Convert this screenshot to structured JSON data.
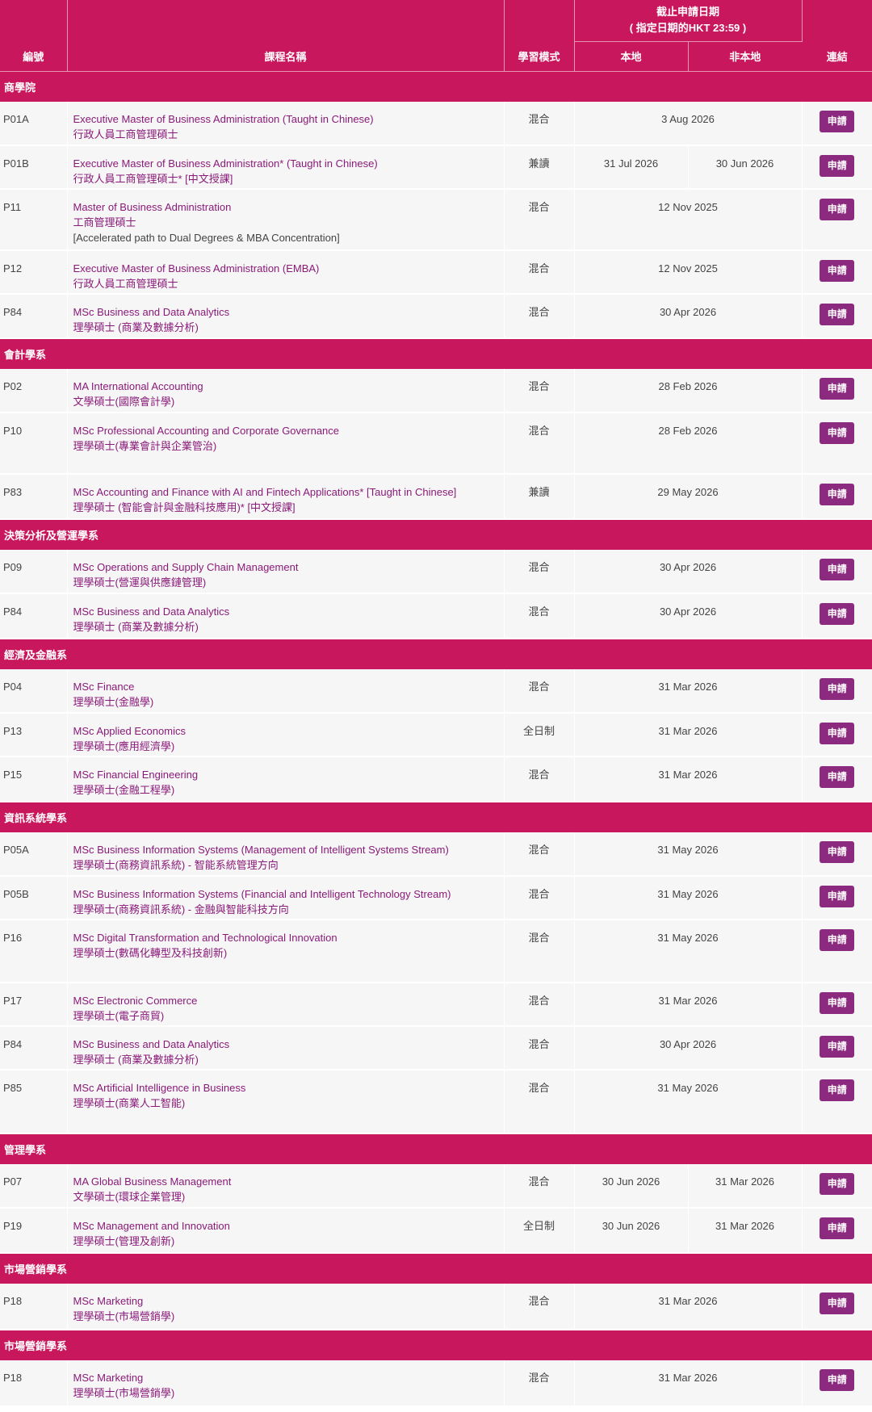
{
  "headers": {
    "code": "編號",
    "name": "課程名稱",
    "mode": "學習模式",
    "deadline_line1": "截止申請日期",
    "deadline_line2": "( 指定日期的HKT 23:59 )",
    "local": "本地",
    "nonlocal": "非本地",
    "link": "連結"
  },
  "apply_label": "申請",
  "sections": [
    {
      "title": "商學院",
      "programmes": [
        {
          "code": "P01A",
          "en": "Executive Master of Business Administration (Taught in Chinese)",
          "zh": "行政人員工商管理碩士",
          "extra": "",
          "mode": "混合",
          "deadline": "3 Aug 2026",
          "local": "",
          "nonlocal": "",
          "h": 54
        },
        {
          "code": "P01B",
          "en": "Executive Master of Business Administration* (Taught in Chinese)",
          "zh": "行政人員工商管理碩士* [中文授課]",
          "extra": "",
          "mode": "兼讀",
          "deadline": "",
          "local": "31 Jul 2026",
          "nonlocal": "30 Jun 2026",
          "h": 54
        },
        {
          "code": "P11",
          "en": "Master of Business Administration",
          "zh": "工商管理碩士",
          "extra": "[Accelerated path to Dual Degrees & MBA Concentration]",
          "mode": "混合",
          "deadline": "12 Nov 2025",
          "local": "",
          "nonlocal": "",
          "h": 76
        },
        {
          "code": "P12",
          "en": "Executive Master of Business Administration (EMBA)",
          "zh": "行政人員工商管理碩士",
          "extra": "",
          "mode": "混合",
          "deadline": "12 Nov 2025",
          "local": "",
          "nonlocal": "",
          "h": 54
        },
        {
          "code": "P84",
          "en": "MSc Business and Data Analytics",
          "zh": "理學碩士 (商業及數據分析)",
          "extra": "",
          "mode": "混合",
          "deadline": "30 Apr 2026",
          "local": "",
          "nonlocal": "",
          "h": 55
        }
      ]
    },
    {
      "title": "會計學系",
      "programmes": [
        {
          "code": "P02",
          "en": "MA International Accounting",
          "zh": "文學碩士(國際會計學)",
          "extra": "",
          "mode": "混合",
          "deadline": "28 Feb 2026",
          "local": "",
          "nonlocal": "",
          "h": 54
        },
        {
          "code": "P10",
          "en": "MSc Professional Accounting and Corporate Governance",
          "zh": "理學碩士(專業會計與企業管治)",
          "extra": "",
          "mode": "混合",
          "deadline": "28 Feb 2026",
          "local": "",
          "nonlocal": "",
          "h": 76
        },
        {
          "code": "P83",
          "en": "MSc Accounting and Finance with AI and Fintech Applications* [Taught in Chinese]",
          "zh": "理學碩士 (智能會計與金融科技應用)* [中文授課]",
          "extra": "",
          "mode": "兼讀",
          "deadline": "29 May 2026",
          "local": "",
          "nonlocal": "",
          "h": 56
        }
      ]
    },
    {
      "title": "決策分析及營運學系",
      "programmes": [
        {
          "code": "P09",
          "en": "MSc Operations and Supply Chain Management",
          "zh": "理學碩士(營運與供應鏈管理)",
          "extra": "",
          "mode": "混合",
          "deadline": "30 Apr 2026",
          "local": "",
          "nonlocal": "",
          "h": 54
        },
        {
          "code": "P84",
          "en": "MSc Business and Data Analytics",
          "zh": "理學碩士 (商業及數據分析)",
          "extra": "",
          "mode": "混合",
          "deadline": "30 Apr 2026",
          "local": "",
          "nonlocal": "",
          "h": 56
        }
      ]
    },
    {
      "title": "經濟及金融系",
      "programmes": [
        {
          "code": "P04",
          "en": "MSc Finance",
          "zh": "理學碩士(金融學)",
          "extra": "",
          "mode": "混合",
          "deadline": "31 Mar 2026",
          "local": "",
          "nonlocal": "",
          "h": 54
        },
        {
          "code": "P13",
          "en": "MSc Applied Economics",
          "zh": "理學碩士(應用經濟學)",
          "extra": "",
          "mode": "全日制",
          "deadline": "31 Mar 2026",
          "local": "",
          "nonlocal": "",
          "h": 54
        },
        {
          "code": "P15",
          "en": "MSc Financial Engineering",
          "zh": "理學碩士(金融工程學)",
          "extra": "",
          "mode": "混合",
          "deadline": "31 Mar 2026",
          "local": "",
          "nonlocal": "",
          "h": 56
        }
      ]
    },
    {
      "title": "資訊系統學系",
      "programmes": [
        {
          "code": "P05A",
          "en": "MSc Business Information Systems (Management of Intelligent Systems Stream)",
          "zh": "理學碩士(商務資訊系統) - 智能系統管理方向",
          "extra": "",
          "mode": "混合",
          "deadline": "31 May 2026",
          "local": "",
          "nonlocal": "",
          "h": 54
        },
        {
          "code": "P05B",
          "en": "MSc Business Information Systems (Financial and Intelligent Technology Stream)",
          "zh": "理學碩士(商務資訊系統) - 金融與智能科技方向",
          "extra": "",
          "mode": "混合",
          "deadline": "31 May 2026",
          "local": "",
          "nonlocal": "",
          "h": 54
        },
        {
          "code": "P16",
          "en": "MSc Digital Transformation and Technological Innovation",
          "zh": "理學碩士(數碼化轉型及科技創新)",
          "extra": "",
          "mode": "混合",
          "deadline": "31 May 2026",
          "local": "",
          "nonlocal": "",
          "h": 78
        },
        {
          "code": "P17",
          "en": "MSc Electronic Commerce",
          "zh": "理學碩士(電子商貿)",
          "extra": "",
          "mode": "混合",
          "deadline": "31 Mar 2026",
          "local": "",
          "nonlocal": "",
          "h": 54
        },
        {
          "code": "P84",
          "en": "MSc Business and Data Analytics",
          "zh": "理學碩士 (商業及數據分析)",
          "extra": "",
          "mode": "混合",
          "deadline": "30 Apr 2026",
          "local": "",
          "nonlocal": "",
          "h": 54
        },
        {
          "code": "P85",
          "en": "MSc Artificial Intelligence in Business",
          "zh": "理學碩士(商業人工智能)",
          "extra": "",
          "mode": "混合",
          "deadline": "31 May 2026",
          "local": "",
          "nonlocal": "",
          "h": 79
        }
      ]
    },
    {
      "title": "管理學系",
      "programmes": [
        {
          "code": "P07",
          "en": "MA Global Business Management",
          "zh": "文學碩士(環球企業管理)",
          "extra": "",
          "mode": "混合",
          "deadline": "",
          "local": "30 Jun 2026",
          "nonlocal": "31 Mar 2026",
          "h": 54
        },
        {
          "code": "P19",
          "en": "MSc Management and Innovation",
          "zh": "理學碩士(管理及創新)",
          "extra": "",
          "mode": "全日制",
          "deadline": "",
          "local": "30 Jun 2026",
          "nonlocal": "31 Mar 2026",
          "h": 56
        }
      ]
    },
    {
      "title": "市場營銷學系",
      "programmes": [
        {
          "code": "P18",
          "en": "MSc Marketing",
          "zh": "理學碩士(市場營銷學)",
          "extra": "",
          "mode": "混合",
          "deadline": "31 Mar 2026",
          "local": "",
          "nonlocal": "",
          "h": 57
        }
      ]
    },
    {
      "title": "市場營銷學系",
      "programmes": [
        {
          "code": "P18",
          "en": "MSc Marketing",
          "zh": "理學碩士(市場營銷學)",
          "extra": "",
          "mode": "混合",
          "deadline": "31 Mar 2026",
          "local": "",
          "nonlocal": "",
          "h": 57
        }
      ]
    }
  ]
}
